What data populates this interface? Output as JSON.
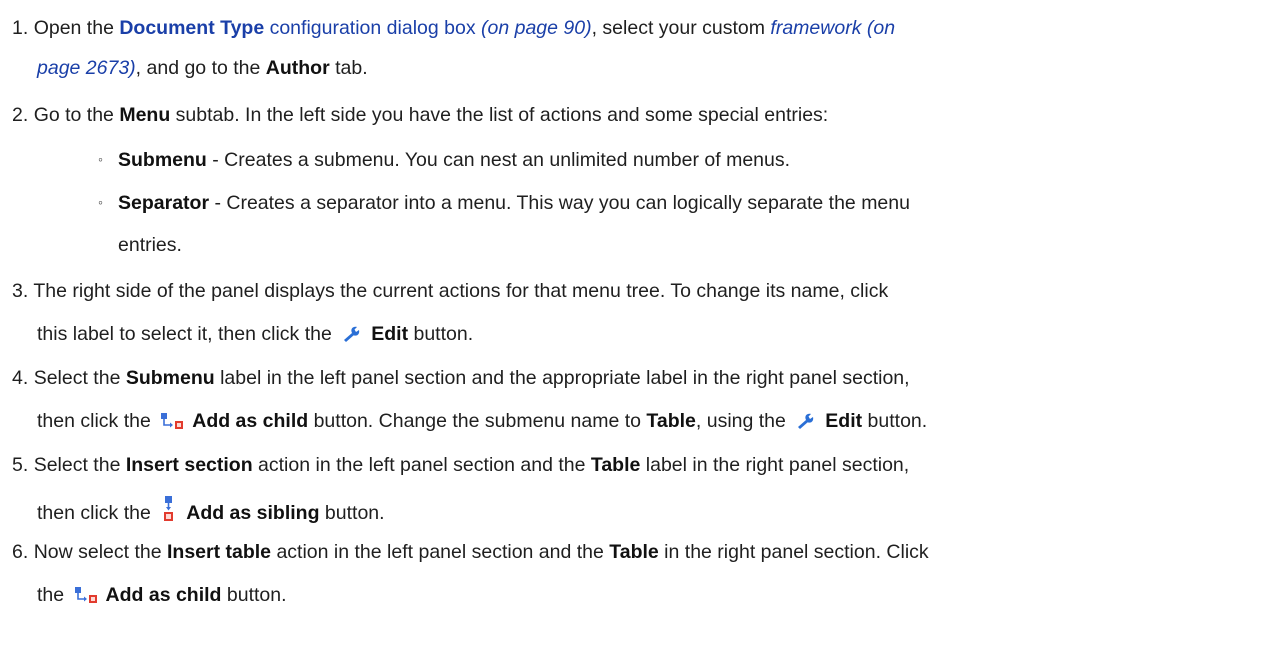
{
  "steps": [
    {
      "number": "1.",
      "t1": "Open the ",
      "link_bold": "Document Type",
      "link_rest": " configuration dialog box",
      "xref1": "(on page 90)",
      "t2": ", select your custom ",
      "xref2_a": "framework (on",
      "xref2_b": "page 2673)",
      "t3": ", and go to the ",
      "b1": "Author",
      "t4": " tab."
    },
    {
      "number": "2.",
      "t1": "Go to the ",
      "b1": "Menu",
      "t2": " subtab. In the left side you have the list of actions and some special entries:",
      "bullets": [
        {
          "marker": "◦",
          "bold": "Submenu",
          "text": " - Creates a submenu. You can nest an unlimited number of menus."
        },
        {
          "marker": "◦",
          "bold": "Separator",
          "text": " - Creates a separator into a menu. This way you can logically separate the menu",
          "cont": "entries."
        }
      ]
    },
    {
      "number": "3.",
      "t1": "The right side of the panel displays the current actions for that menu tree. To change its name, click",
      "t2": "this label to select it, then click the ",
      "icon": "wrench-icon",
      "b1": "Edit",
      "t3": " button."
    },
    {
      "number": "4.",
      "t1": "Select the ",
      "b1": "Submenu",
      "t2": " label in the left panel section and the appropriate label in the right panel section,",
      "t3": "then click the ",
      "icon1": "add-as-child-icon",
      "b2": "Add as child",
      "t4": " button. Change the submenu name to ",
      "b3": "Table",
      "t5": ", using the ",
      "icon2": "wrench-icon",
      "b4": "Edit",
      "t6": " button."
    },
    {
      "number": "5.",
      "t1": "Select the ",
      "b1": "Insert section",
      "t2": " action in the left panel section and the ",
      "b2": "Table",
      "t3": " label in the right panel section,",
      "t4": "then click the ",
      "icon": "add-as-sibling-icon",
      "b3": "Add as sibling",
      "t5": " button."
    },
    {
      "number": "6.",
      "t1": "Now select the ",
      "b1": "Insert table",
      "t2": " action in the left panel section and the ",
      "b2": "Table",
      "t3": " in the right panel section. Click",
      "t4": "the ",
      "icon": "add-as-child-icon",
      "b3": "Add as child",
      "t5": " button."
    }
  ],
  "colors": {
    "link": "#1a3fa8",
    "text": "#1f1f1f",
    "wrench": "#2a6fd6",
    "node_blue": "#3a6fd8",
    "node_red": "#e23b2e"
  }
}
